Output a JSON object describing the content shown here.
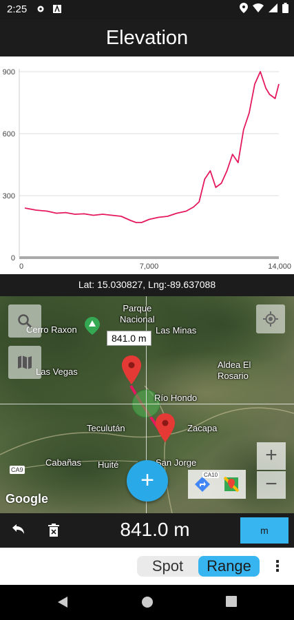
{
  "status_bar": {
    "time": "2:25"
  },
  "app_bar": {
    "title": "Elevation"
  },
  "chart_data": {
    "type": "line",
    "title": "",
    "xlabel": "",
    "ylabel": "",
    "xlim": [
      0,
      14000
    ],
    "ylim": [
      0,
      900
    ],
    "x_ticks": [
      "0",
      "7,000",
      "14,000"
    ],
    "y_ticks": [
      "0",
      "300",
      "600",
      "900"
    ],
    "grid": true,
    "series": [
      {
        "color": "#e5175f",
        "x": [
          300,
          900,
          1500,
          2000,
          2500,
          3000,
          3500,
          4000,
          4500,
          5000,
          5500,
          6000,
          6300,
          6600,
          7000,
          7500,
          8000,
          8500,
          9000,
          9400,
          9700,
          10000,
          10300,
          10600,
          10900,
          11200,
          11500,
          11800,
          12100,
          12400,
          12700,
          13000,
          13300,
          13500,
          13800,
          14000
        ],
        "y": [
          240,
          230,
          225,
          215,
          218,
          210,
          212,
          205,
          210,
          205,
          200,
          180,
          170,
          170,
          185,
          195,
          200,
          215,
          225,
          245,
          270,
          380,
          420,
          340,
          360,
          420,
          500,
          460,
          620,
          700,
          840,
          900,
          820,
          790,
          770,
          840
        ]
      }
    ]
  },
  "coords": {
    "text": "Lat: 15.030827, Lng:-89.637088"
  },
  "map": {
    "places": {
      "parque": "Parque\nNacional",
      "las_minas": "Las Minas",
      "cerro_raxon": "Cerro Raxon",
      "las_vegas": "Las Vegas",
      "aldea": "Aldea El\nRosario",
      "rio_hondo": "Río Hondo",
      "teculutan": "Teculután",
      "zacapa": "Zacapa",
      "cabanas": "Cabañas",
      "huite": "Huité",
      "san_jorge": "San Jorge"
    },
    "route_signs": {
      "ca9": "CA9",
      "ca10": "CA10"
    },
    "distance_label": "841.0 m",
    "google": "Google",
    "zoom_in": "+",
    "zoom_out": "−",
    "fab": "+"
  },
  "toolbar": {
    "distance": "841.0 m",
    "unit": "m"
  },
  "modes": {
    "spot": "Spot",
    "range": "Range",
    "more": "⋮"
  },
  "colors": {
    "accent": "#37b5f0",
    "line": "#e5175f",
    "dark": "#1c1c1c"
  }
}
